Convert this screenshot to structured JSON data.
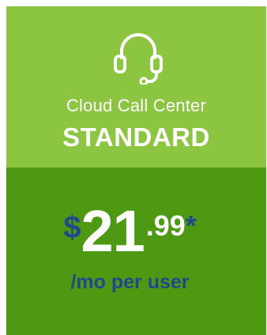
{
  "plan": {
    "product_line": "Cloud Call Center",
    "tier": "STANDARD",
    "icon": "headset-icon"
  },
  "price": {
    "currency": "$",
    "dollars": "21",
    "cents": ".99",
    "asterisk": "*",
    "period": "/mo per user"
  },
  "colors": {
    "top_background": "#8cc540",
    "bottom_background": "#4d9a12",
    "accent_blue": "#1e4a8d",
    "text_white": "#ffffff"
  }
}
